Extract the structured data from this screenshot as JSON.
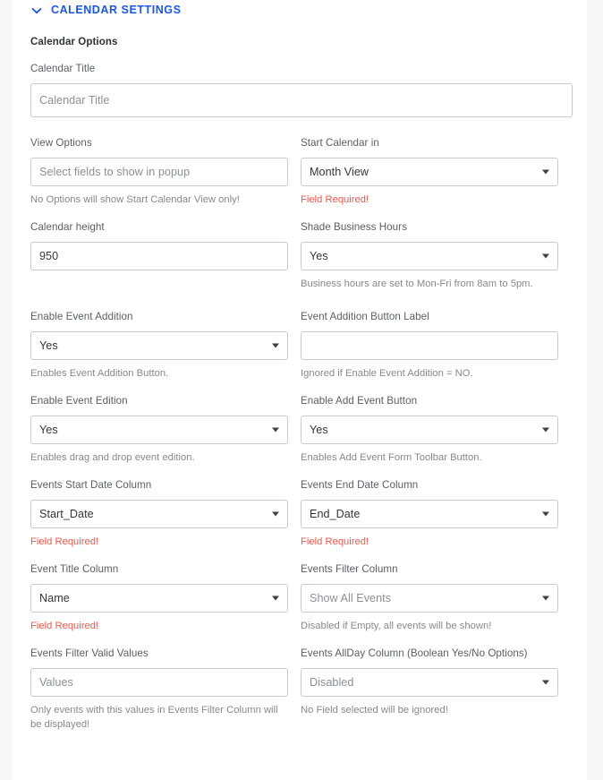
{
  "section": {
    "title": "CALENDAR SETTINGS",
    "chevron_icon": "chevron-down-icon",
    "accent_color": "#1a56f0",
    "expanded": true
  },
  "group": {
    "title": "Calendar Options"
  },
  "colors": {
    "accent": "#1a56f0",
    "error": "#f4574b",
    "label": "#595f66",
    "help": "#85898f",
    "border": "#c4cbd3",
    "page_bg": "#f7f7f8",
    "panel_bg": "#ffffff"
  },
  "fields": {
    "calendar_title": {
      "label": "Calendar Title",
      "value": "",
      "placeholder": "Calendar Title",
      "type": "text"
    },
    "view_options": {
      "label": "View Options",
      "value": "",
      "placeholder": "Select fields to show in popup",
      "type": "text",
      "help": "No Options will show Start Calendar View only!"
    },
    "start_calendar_in": {
      "label": "Start Calendar in",
      "value": "Month View",
      "type": "select",
      "error": "Field Required!"
    },
    "calendar_height": {
      "label": "Calendar height",
      "value": "950",
      "type": "text"
    },
    "shade_business_hours": {
      "label": "Shade Business Hours",
      "value": "Yes",
      "type": "select",
      "help": "Business hours are set to Mon-Fri from 8am to 5pm."
    },
    "enable_event_addition": {
      "label": "Enable Event Addition",
      "value": "Yes",
      "type": "select",
      "help": "Enables Event Addition Button."
    },
    "event_addition_button_label": {
      "label": "Event Addition Button Label",
      "value": "",
      "placeholder": "",
      "type": "text",
      "help": "Ignored if Enable Event Addition = NO."
    },
    "enable_event_edition": {
      "label": "Enable Event Edition",
      "value": "Yes",
      "type": "select",
      "help": "Enables drag and drop event edition."
    },
    "enable_add_event_button": {
      "label": "Enable Add Event Button",
      "value": "Yes",
      "type": "select",
      "help": "Enables Add Event Form Toolbar Button."
    },
    "events_start_date_column": {
      "label": "Events Start Date Column",
      "value": "Start_Date",
      "type": "select",
      "error": "Field Required!"
    },
    "events_end_date_column": {
      "label": "Events End Date Column",
      "value": "End_Date",
      "type": "select",
      "error": "Field Required!"
    },
    "event_title_column": {
      "label": "Event Title Column",
      "value": "Name",
      "type": "select",
      "error": "Field Required!"
    },
    "events_filter_column": {
      "label": "Events Filter Column",
      "value": "Show All Events",
      "type": "select",
      "is_placeholder": true,
      "help": "Disabled if Empty, all events will be shown!"
    },
    "events_filter_valid_values": {
      "label": "Events Filter Valid Values",
      "value": "",
      "placeholder": "Values",
      "type": "text",
      "help": "Only events with this values in Events Filter Column will be displayed!"
    },
    "events_allday_column": {
      "label": "Events AllDay Column (Boolean Yes/No Options)",
      "value": "Disabled",
      "type": "select",
      "is_placeholder": true,
      "help": "No Field selected will be ignored!"
    }
  }
}
